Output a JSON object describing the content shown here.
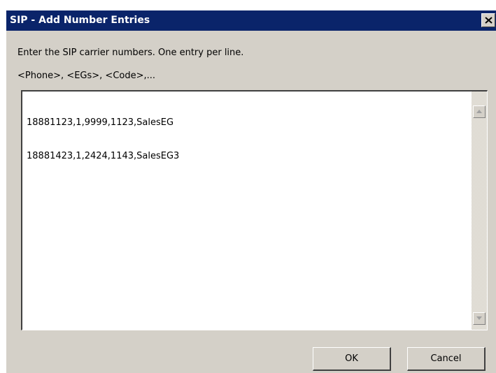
{
  "window": {
    "title": "SIP - Add Number Entries",
    "close_icon": "close-icon"
  },
  "instruction": "Enter the SIP carrier numbers. One entry per line.",
  "format_hint": "<Phone>, <EGs>, <Code>,...",
  "entries": [
    "18881123,1,9999,1123,SalesEG",
    "18881423,1,2424,1143,SalesEG3"
  ],
  "scrollbar": {
    "up_icon": "arrow-up-icon",
    "down_icon": "arrow-down-icon"
  },
  "buttons": {
    "ok": "OK",
    "cancel": "Cancel"
  },
  "colors": {
    "titlebar": "#0a246a",
    "dialog_bg": "#d4d0c8"
  }
}
